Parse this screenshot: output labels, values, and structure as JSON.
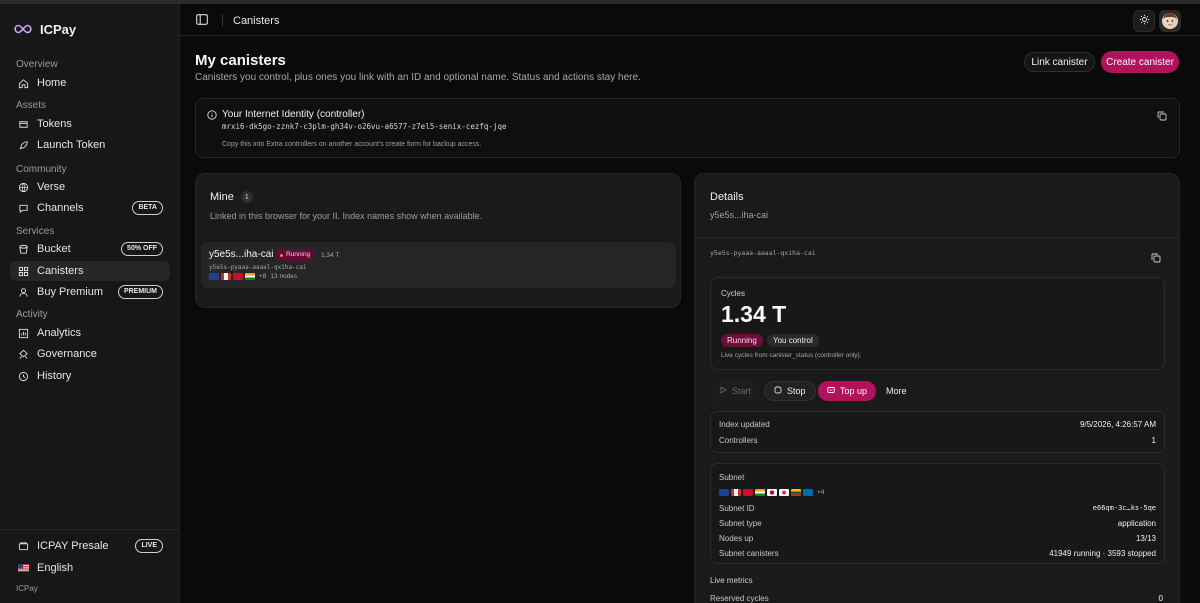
{
  "brand": {
    "name": "ICPay"
  },
  "sidebar": {
    "sections": [
      {
        "label": "Overview",
        "items": [
          {
            "label": "Home",
            "icon": "home-icon"
          }
        ]
      },
      {
        "label": "Assets",
        "items": [
          {
            "label": "Tokens",
            "icon": "tokens-icon"
          },
          {
            "label": "Launch Token",
            "icon": "rocket-icon"
          }
        ]
      },
      {
        "label": "Community",
        "items": [
          {
            "label": "Verse",
            "icon": "globe-icon"
          },
          {
            "label": "Channels",
            "icon": "chat-icon",
            "badge": "BETA"
          }
        ]
      },
      {
        "label": "Services",
        "items": [
          {
            "label": "Bucket",
            "icon": "bucket-icon",
            "badge": "50% OFF"
          },
          {
            "label": "Canisters",
            "icon": "grid-icon",
            "active": true
          },
          {
            "label": "Buy Premium",
            "icon": "user-icon",
            "badge": "PREMIUM"
          }
        ]
      },
      {
        "label": "Activity",
        "items": [
          {
            "label": "Analytics",
            "icon": "chart-icon"
          },
          {
            "label": "Governance",
            "icon": "governance-icon"
          },
          {
            "label": "History",
            "icon": "clock-icon"
          }
        ]
      }
    ],
    "footer": {
      "presale_label": "ICPAY Presale",
      "presale_badge": "LIVE",
      "language": "English",
      "brand_small": "ICPay"
    }
  },
  "topbar": {
    "breadcrumb": "Canisters"
  },
  "header": {
    "title": "My canisters",
    "subtitle": "Canisters you control, plus ones you link with an ID and optional name. Status and actions stay here.",
    "link_button": "Link canister",
    "create_button": "Create canister"
  },
  "identity": {
    "title": "Your Internet Identity (controller)",
    "principal": "mrxi6-dk5go-zznk7-c3plm-gh34v-o26vu-a6577-z7el5-senix-cezfq-jqe",
    "hint": "Copy this into Extra controllers on another account's create form for backup access."
  },
  "mine": {
    "title": "Mine",
    "count": "1",
    "subtitle": "Linked in this browser for your II. Index names show when available.",
    "canisters": [
      {
        "short_name": "y5e5s...iha-cai",
        "status": "Running",
        "cycles": "1.34 T",
        "id": "y5e5s-pyaaa-aaaal-qxiha-cai",
        "extra_flags": "+8",
        "nodes": "13 nodes"
      }
    ]
  },
  "details": {
    "title": "Details",
    "subtitle": "y5e5s...iha-cai",
    "canister_id": "y5e5s-pyaaa-aaaal-qxiha-cai",
    "cycles_label": "Cycles",
    "cycles_value": "1.34 T",
    "status_badge": "Running",
    "control_badge": "You control",
    "cycles_hint": "Live cycles from canister_status (controller only).",
    "actions": {
      "start": "Start",
      "stop": "Stop",
      "topup": "Top up",
      "more": "More"
    },
    "meta": [
      {
        "key": "Index updated",
        "value": "9/5/2026, 4:26:57 AM"
      },
      {
        "key": "Controllers",
        "value": "1"
      }
    ],
    "subnet": {
      "label": "Subnet",
      "extra_flags": "+4",
      "rows": [
        {
          "key": "Subnet ID",
          "value": "e66qm-3c…ks-5qe"
        },
        {
          "key": "Subnet type",
          "value": "application"
        },
        {
          "key": "Nodes up",
          "value": "13/13"
        },
        {
          "key": "Subnet canisters",
          "value": "41949 running · 3593 stopped"
        }
      ]
    },
    "live_metrics_label": "Live metrics",
    "reserved_cycles": {
      "key": "Reserved cycles",
      "value": "0"
    }
  },
  "colors": {
    "accent": "#b0135c",
    "background": "#0a0a0a",
    "panel": "#1a1a1a"
  }
}
